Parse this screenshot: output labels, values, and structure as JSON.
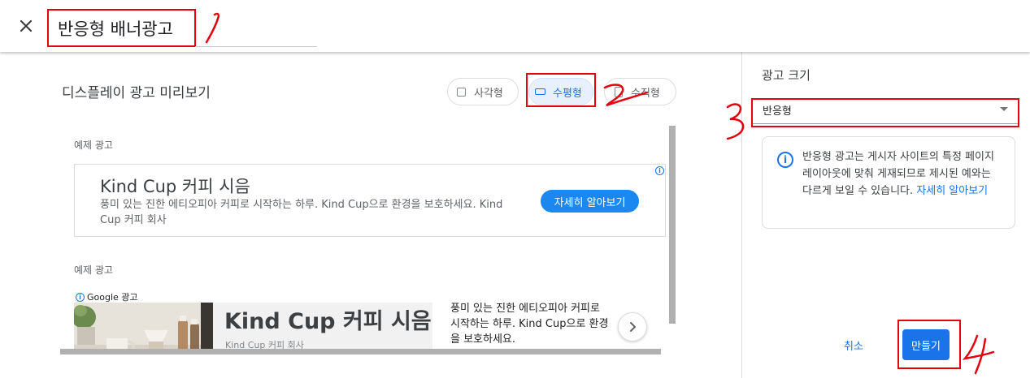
{
  "header": {
    "title": "반응형 배너광고",
    "close_icon": "close-icon"
  },
  "preview": {
    "title": "디스플레이 광고 미리보기",
    "shape_options": [
      {
        "label": "사각형",
        "selected": false
      },
      {
        "label": "수평형",
        "selected": true
      },
      {
        "label": "수직형",
        "selected": false
      }
    ],
    "ad1": {
      "section_label": "예제 광고",
      "headline": "Kind Cup 커피 시음",
      "description": "풍미 있는 진한 에티오피아 커피로 시작하는 하루. Kind Cup으로 환경을 보호하세요. Kind Cup 커피 회사",
      "cta": "자세히 알아보기"
    },
    "ad2": {
      "section_label": "예제 광고",
      "badge": "Google 광고",
      "headline": "Kind Cup 커피 시음",
      "brand": "Kind Cup 커피 회사",
      "description": "풍미 있는 진한 에티오피아 커피로 시작하는 하루. Kind Cup으로 환경을 보호하세요."
    }
  },
  "panel": {
    "size_label": "광고 크기",
    "select_value": "반응형",
    "info_text": "반응형 광고는 게시자 사이트의 특정 페이지 레이아웃에 맞춰 게재되므로 제시된 예와는 다르게 보일 수 있습니다.",
    "info_link": "자세히 알아보기",
    "cancel": "취소",
    "create": "만들기"
  },
  "colors": {
    "accent": "#1a73e8",
    "annotation_red": "#e3000f"
  }
}
